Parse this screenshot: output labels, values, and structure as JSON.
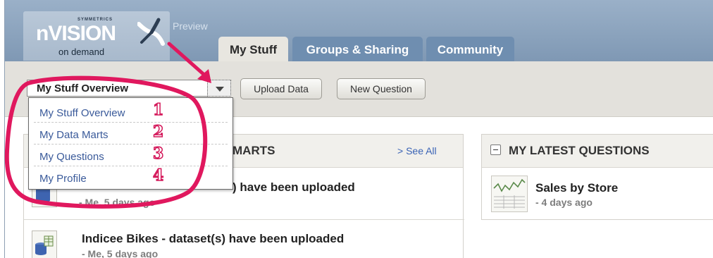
{
  "header": {
    "logo": {
      "brand_small": "SYMMETRICS",
      "brand": "nVISION",
      "tagline": "on demand"
    },
    "preview_label": "Preview",
    "tabs": [
      {
        "label": "My Stuff",
        "active": true
      },
      {
        "label": "Groups & Sharing",
        "active": false
      },
      {
        "label": "Community",
        "active": false
      }
    ]
  },
  "toolbar": {
    "view_select": {
      "value": "My Stuff Overview"
    },
    "upload_label": "Upload Data",
    "new_question_label": "New Question"
  },
  "dropdown": {
    "items": [
      {
        "label": "My Stuff Overview",
        "number": "1"
      },
      {
        "label": "My Data Marts",
        "number": "2"
      },
      {
        "label": "My Questions",
        "number": "3"
      },
      {
        "label": "My Profile",
        "number": "4"
      }
    ]
  },
  "data_marts_panel": {
    "title": "MARTS",
    "see_all": "> See All",
    "items": [
      {
        "title": ") have been uploaded",
        "meta": "- Me, 5 days ago"
      },
      {
        "title": "Indicee Bikes - dataset(s) have been uploaded",
        "meta": "- Me, 5 days ago"
      }
    ]
  },
  "questions_panel": {
    "title": "MY LATEST QUESTIONS",
    "items": [
      {
        "title": "Sales by Store",
        "meta": "- 4 days ago"
      }
    ]
  },
  "colors": {
    "header_bg": "#8aa2bc",
    "active_tab": "#e8e6e0",
    "inactive_tab": "#6f8eb0",
    "link": "#3a63b5",
    "annotation": "#d4185a"
  }
}
